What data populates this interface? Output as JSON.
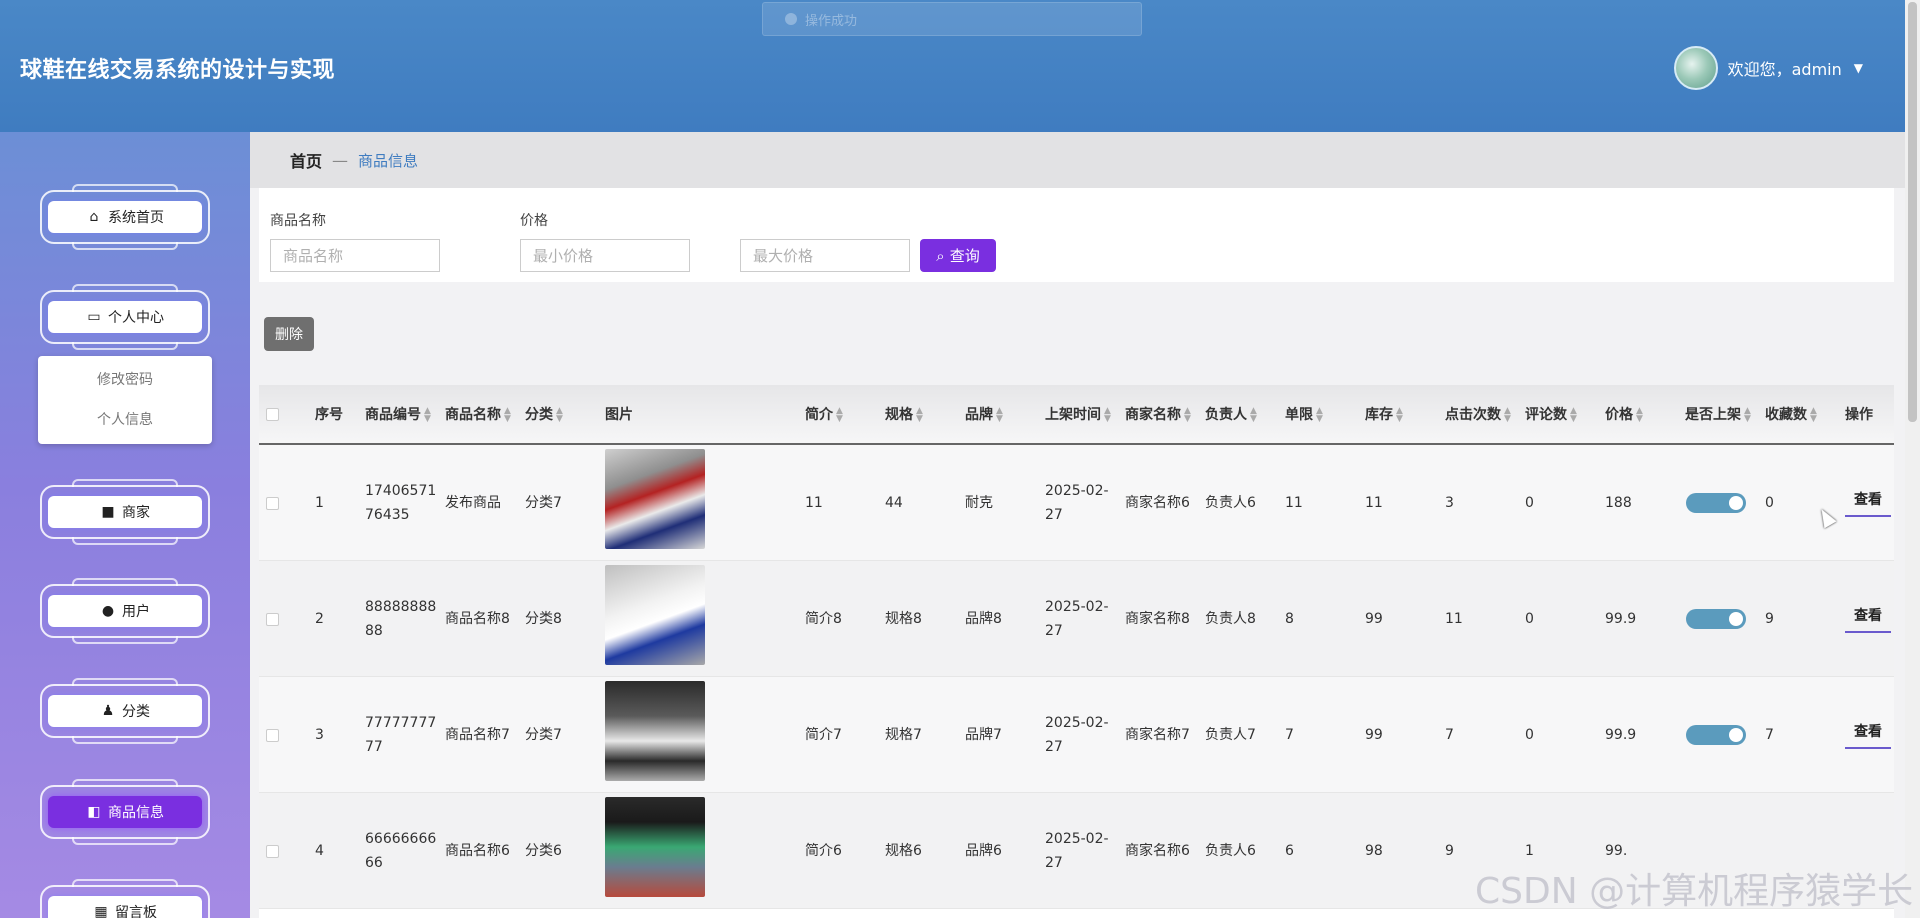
{
  "app": {
    "title": "球鞋在线交易系统的设计与实现",
    "welcome": "欢迎您，admin",
    "toast": "操作成功"
  },
  "sidebar": {
    "items": [
      {
        "label": "系统首页",
        "icon": "home-icon"
      },
      {
        "label": "个人中心",
        "icon": "card-icon"
      },
      {
        "label": "商家",
        "icon": "monitor-icon"
      },
      {
        "label": "用户",
        "icon": "bulb-icon"
      },
      {
        "label": "分类",
        "icon": "person-icon"
      },
      {
        "label": "商品信息",
        "icon": "cart-icon"
      },
      {
        "label": "留言板",
        "icon": "grid-icon"
      }
    ],
    "submenu": [
      "修改密码",
      "个人信息"
    ]
  },
  "breadcrumb": {
    "home": "首页",
    "sep": "—",
    "current": "商品信息"
  },
  "search": {
    "name_label": "商品名称",
    "name_placeholder": "商品名称",
    "price_label": "价格",
    "min_placeholder": "最小价格",
    "max_placeholder": "最大价格",
    "query_label": "查询"
  },
  "actions": {
    "delete_label": "删除"
  },
  "table": {
    "headers": [
      "序号",
      "商品编号",
      "商品名称",
      "分类",
      "图片",
      "简介",
      "规格",
      "品牌",
      "上架时间",
      "商家名称",
      "负责人",
      "单限",
      "库存",
      "点击次数",
      "评论数",
      "价格",
      "是否上架",
      "收藏数",
      "操作"
    ],
    "view_label": "查看",
    "rows": [
      {
        "idx": "1",
        "code": "1740657176435",
        "name": "发布商品",
        "category": "分类7",
        "intro": "11",
        "spec": "44",
        "brand": "耐克",
        "date": "2025-02-27",
        "merchant": "商家名称6",
        "owner": "负责人6",
        "limit": "11",
        "stock": "11",
        "clicks": "3",
        "comments": "0",
        "price": "188",
        "listed": true,
        "favorites": "0"
      },
      {
        "idx": "2",
        "code": "8888888888",
        "name": "商品名称8",
        "category": "分类8",
        "intro": "简介8",
        "spec": "规格8",
        "brand": "品牌8",
        "date": "2025-02-27",
        "merchant": "商家名称8",
        "owner": "负责人8",
        "limit": "8",
        "stock": "99",
        "clicks": "11",
        "comments": "0",
        "price": "99.9",
        "listed": true,
        "favorites": "9"
      },
      {
        "idx": "3",
        "code": "7777777777",
        "name": "商品名称7",
        "category": "分类7",
        "intro": "简介7",
        "spec": "规格7",
        "brand": "品牌7",
        "date": "2025-02-27",
        "merchant": "商家名称7",
        "owner": "负责人7",
        "limit": "7",
        "stock": "99",
        "clicks": "7",
        "comments": "0",
        "price": "99.9",
        "listed": true,
        "favorites": "7"
      },
      {
        "idx": "4",
        "code": "6666666666",
        "name": "商品名称6",
        "category": "分类6",
        "intro": "简介6",
        "spec": "规格6",
        "brand": "品牌6",
        "date": "2025-02-27",
        "merchant": "商家名称6",
        "owner": "负责人6",
        "limit": "6",
        "stock": "98",
        "clicks": "9",
        "comments": "1",
        "price": "99.",
        "listed": true,
        "favorites": ""
      }
    ]
  },
  "watermark": "CSDN @计算机程序猿学长"
}
